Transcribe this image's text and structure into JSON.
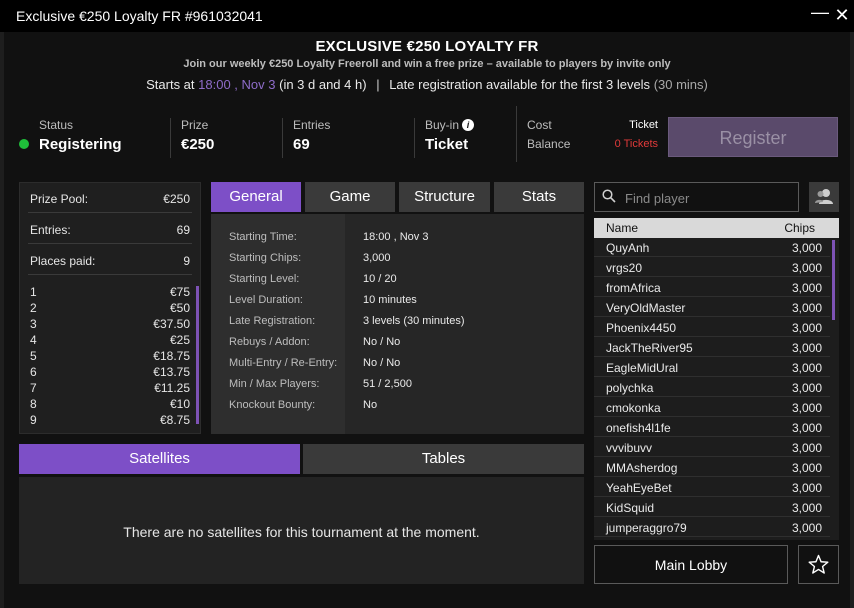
{
  "window": {
    "title": "Exclusive €250 Loyalty FR #961032041",
    "min_glyph": "—",
    "close_glyph": "✕"
  },
  "header": {
    "title": "EXCLUSIVE €250 LOYALTY FR",
    "subtitle": "Join our weekly €250 Loyalty Freeroll and win a free prize – available to players by invite only",
    "starts_prefix": "Starts at",
    "starts_time": "18:00 , Nov 3",
    "starts_in": "(in 3 d and 4 h)",
    "sep": "|",
    "late_reg": "Late registration available for the first 3 levels",
    "late_reg_mins": "(30 mins)"
  },
  "info": {
    "status_label": "Status",
    "status_value": "Registering",
    "prize_label": "Prize",
    "prize_value": "€250",
    "entries_label": "Entries",
    "entries_value": "69",
    "buyin_label": "Buy-in",
    "buyin_value": "Ticket",
    "cost_label": "Cost",
    "cost_value": "Ticket",
    "balance_label": "Balance",
    "balance_value": "0 Tickets",
    "register_label": "Register"
  },
  "summary": {
    "prize_pool_label": "Prize Pool:",
    "prize_pool_value": "€250",
    "entries_label": "Entries:",
    "entries_value": "69",
    "places_label": "Places paid:",
    "places_value": "9",
    "places": [
      {
        "pos": "1",
        "amount": "€75"
      },
      {
        "pos": "2",
        "amount": "€50"
      },
      {
        "pos": "3",
        "amount": "€37.50"
      },
      {
        "pos": "4",
        "amount": "€25"
      },
      {
        "pos": "5",
        "amount": "€18.75"
      },
      {
        "pos": "6",
        "amount": "€13.75"
      },
      {
        "pos": "7",
        "amount": "€11.25"
      },
      {
        "pos": "8",
        "amount": "€10"
      },
      {
        "pos": "9",
        "amount": "€8.75"
      }
    ]
  },
  "tabs": [
    "General",
    "Game",
    "Structure",
    "Stats"
  ],
  "details": [
    {
      "label": "Starting Time:",
      "value": "18:00 , Nov 3"
    },
    {
      "label": "Starting Chips:",
      "value": "3,000"
    },
    {
      "label": "Starting Level:",
      "value": "10 / 20"
    },
    {
      "label": "Level Duration:",
      "value": "10 minutes"
    },
    {
      "label": "Late Registration:",
      "value": "3 levels (30 minutes)"
    },
    {
      "label": "Rebuys / Addon:",
      "value": "No / No"
    },
    {
      "label": "Multi-Entry / Re-Entry:",
      "value": "No / No"
    },
    {
      "label": "Min / Max Players:",
      "value": "51 / 2,500"
    },
    {
      "label": "Knockout Bounty:",
      "value": "No"
    }
  ],
  "lower_tabs": {
    "satellites": "Satellites",
    "tables": "Tables"
  },
  "lower_message": "There are no satellites for this tournament at the moment.",
  "search": {
    "placeholder": "Find player"
  },
  "players": {
    "name_header": "Name",
    "chips_header": "Chips",
    "rows": [
      {
        "name": "QuyAnh",
        "chips": "3,000"
      },
      {
        "name": "vrgs20",
        "chips": "3,000"
      },
      {
        "name": "fromAfrica",
        "chips": "3,000"
      },
      {
        "name": "VeryOldMaster",
        "chips": "3,000"
      },
      {
        "name": "Phoenix4450",
        "chips": "3,000"
      },
      {
        "name": "JackTheRiver95",
        "chips": "3,000"
      },
      {
        "name": "EagleMidUral",
        "chips": "3,000"
      },
      {
        "name": "polychka",
        "chips": "3,000"
      },
      {
        "name": "cmokonka",
        "chips": "3,000"
      },
      {
        "name": "onefish4l1fe",
        "chips": "3,000"
      },
      {
        "name": "vvvibuvv",
        "chips": "3,000"
      },
      {
        "name": "MMAsherdog",
        "chips": "3,000"
      },
      {
        "name": "YeahEyeBet",
        "chips": "3,000"
      },
      {
        "name": "KidSquid",
        "chips": "3,000"
      },
      {
        "name": "jumperaggro79",
        "chips": "3,000"
      }
    ]
  },
  "main_lobby_label": "Main Lobby",
  "colors": {
    "accent": "#7d4fc7",
    "status_green": "#1fbf3a",
    "balance_red": "#e03a3a",
    "date_purple": "#8e6cc9"
  },
  "icons": {
    "search": "magnifier-icon",
    "users": "users-icon",
    "star": "star-icon",
    "info": "info-icon"
  }
}
